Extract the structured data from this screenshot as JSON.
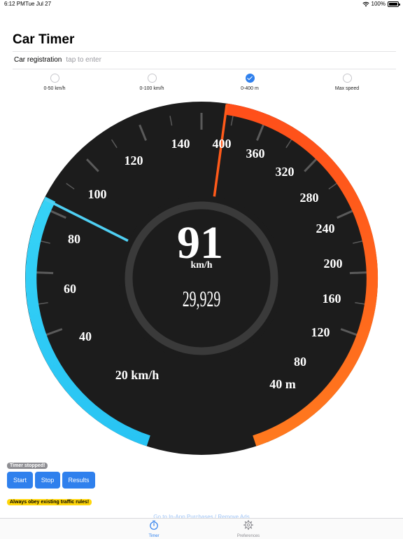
{
  "status_bar": {
    "time": "6:12 PM",
    "date": "Tue Jul 27",
    "battery": "100%"
  },
  "page": {
    "title": "Car Timer"
  },
  "registration": {
    "label": "Car registration",
    "placeholder": "tap to enter",
    "value": ""
  },
  "modes": [
    {
      "label": "0-50 km/h",
      "selected": false
    },
    {
      "label": "0-100 km/h",
      "selected": false
    },
    {
      "label": "0-400 m",
      "selected": true
    },
    {
      "label": "Max speed",
      "selected": false
    }
  ],
  "gauge": {
    "speed": "91",
    "speed_unit": "km/h",
    "distance": "29,929",
    "speed_scale_labels": [
      "20  km/h",
      "40",
      "60",
      "80",
      "100",
      "120",
      "140"
    ],
    "distance_scale_labels": [
      "400",
      "360",
      "320",
      "280",
      "240",
      "200",
      "160",
      "120",
      "80",
      "40  m"
    ],
    "colors": {
      "speed_arc": "#2ec7f2",
      "distance_arc": "#ff6a1a",
      "needle_speed": "#4fd0f4",
      "needle_distance": "#ff5a1a",
      "dial": "#1c1c1c"
    }
  },
  "timer": {
    "status": "Timer stopped!"
  },
  "buttons": {
    "start": "Start",
    "stop": "Stop",
    "results": "Results"
  },
  "warning": "Always obey existing traffic rules!",
  "iap_link": "Go to In-App Purchases / Remove Ads",
  "tabs": [
    {
      "label": "Timer",
      "icon": "stopwatch-icon",
      "active": true
    },
    {
      "label": "Preferences",
      "icon": "gear-icon",
      "active": false
    }
  ]
}
